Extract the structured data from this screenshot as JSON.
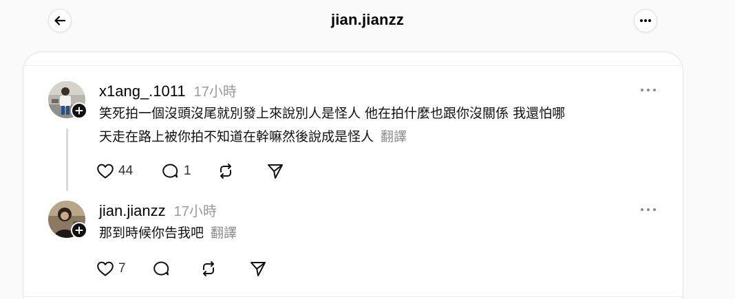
{
  "header": {
    "title": "jian.jianzz"
  },
  "posts": [
    {
      "username": "x1ang_.1011",
      "time": "17小時",
      "lines": [
        "笑死拍一個沒頭沒尾就別發上來說別人是怪人 他在拍什麼也跟你沒關係 我還怕哪",
        "天走在路上被你拍不知道在幹嘛然後說成是怪人"
      ],
      "translate_label": "翻譯",
      "likes": "44",
      "replies": "1"
    },
    {
      "username": "jian.jianzz",
      "time": "17小時",
      "lines": [
        "那到時候你告我吧"
      ],
      "translate_label": "翻譯",
      "likes": "7"
    }
  ],
  "icons": {
    "back": "arrow-left-icon",
    "more": "more-horizontal-icon",
    "like": "heart-icon",
    "reply": "comment-bubble-icon",
    "repost": "repost-icon",
    "share": "send-icon",
    "follow": "plus-icon"
  },
  "colors": {
    "background": "#fafafa",
    "card": "#ffffff",
    "muted_text": "#9a9a9a",
    "badge": "#111111"
  }
}
